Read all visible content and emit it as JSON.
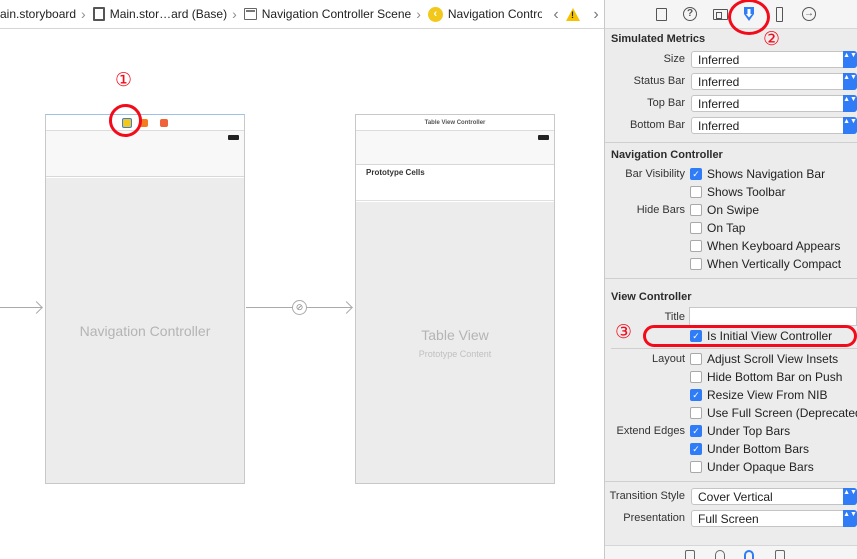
{
  "breadcrumb": {
    "items": [
      {
        "label": "ain.storyboard",
        "icon": "storyboard-file-icon"
      },
      {
        "label": "Main.stor…ard (Base)",
        "icon": "storyboard-base-icon"
      },
      {
        "label": "Navigation Controller Scene",
        "icon": "scene-icon"
      },
      {
        "label": "Navigation Controller",
        "icon": "navigation-controller-icon"
      }
    ],
    "warning_glyph": "!",
    "prev_arrow": "‹",
    "next_arrow": "›"
  },
  "canvas": {
    "nav_scene": {
      "body_title": "Navigation Controller"
    },
    "table_scene": {
      "dock_title": "Table View Controller",
      "prototype_header": "Prototype Cells",
      "body_title": "Table View",
      "body_subtitle": "Prototype Content"
    }
  },
  "annotations": {
    "one": "①",
    "two": "②",
    "three": "③",
    "color": "#f20b1a"
  },
  "inspector": {
    "tabs": [
      {
        "name": "file-inspector",
        "icon": "document-icon"
      },
      {
        "name": "quick-help",
        "icon": "help-icon",
        "glyph": "?"
      },
      {
        "name": "identity-inspector",
        "icon": "id-card-icon"
      },
      {
        "name": "attributes-inspector",
        "icon": "attributes-icon",
        "selected": true
      },
      {
        "name": "size-inspector",
        "icon": "ruler-icon"
      },
      {
        "name": "connections-inspector",
        "icon": "arrow-circle-icon",
        "glyph": "→"
      }
    ],
    "simulated_metrics": {
      "title": "Simulated Metrics",
      "rows": [
        {
          "label": "Size",
          "value": "Inferred"
        },
        {
          "label": "Status Bar",
          "value": "Inferred"
        },
        {
          "label": "Top Bar",
          "value": "Inferred"
        },
        {
          "label": "Bottom Bar",
          "value": "Inferred"
        }
      ]
    },
    "navigation_controller": {
      "title": "Navigation Controller",
      "bar_visibility_label": "Bar Visibility",
      "hide_bars_label": "Hide Bars",
      "options": [
        {
          "label": "Shows Navigation Bar",
          "checked": true
        },
        {
          "label": "Shows Toolbar",
          "checked": false
        },
        {
          "label": "On Swipe",
          "checked": false
        },
        {
          "label": "On Tap",
          "checked": false
        },
        {
          "label": "When Keyboard Appears",
          "checked": false
        },
        {
          "label": "When Vertically Compact",
          "checked": false
        }
      ]
    },
    "view_controller": {
      "title": "View Controller",
      "title_label": "Title",
      "title_value": "",
      "is_initial": {
        "label": "Is Initial View Controller",
        "checked": true
      },
      "layout_label": "Layout",
      "layout_options": [
        {
          "label": "Adjust Scroll View Insets",
          "checked": false
        },
        {
          "label": "Hide Bottom Bar on Push",
          "checked": false
        },
        {
          "label": "Resize View From NIB",
          "checked": true
        },
        {
          "label": "Use Full Screen (Deprecated)",
          "checked": false
        }
      ],
      "extend_edges_label": "Extend Edges",
      "extend_options": [
        {
          "label": "Under Top Bars",
          "checked": true
        },
        {
          "label": "Under Bottom Bars",
          "checked": true
        },
        {
          "label": "Under Opaque Bars",
          "checked": false
        }
      ]
    },
    "transition_style": {
      "label": "Transition Style",
      "value": "Cover Vertical"
    },
    "presentation": {
      "label": "Presentation",
      "value": "Full Screen"
    },
    "checkmark": "✓",
    "popup_chevron": "▲▼",
    "accent_color": "#2f7cf6"
  }
}
